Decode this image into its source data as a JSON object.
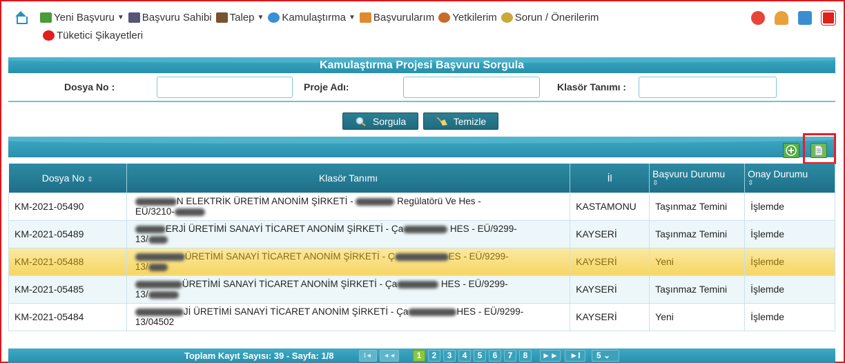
{
  "nav": {
    "items": [
      {
        "label": "Yeni Başvuru",
        "caret": "▼",
        "icon": "new-application-icon",
        "color": "#4a9b3a"
      },
      {
        "label": "Başvuru Sahibi",
        "caret": "",
        "icon": "applicant-icon",
        "color": "#555577"
      },
      {
        "label": "Talep",
        "caret": "▼",
        "icon": "request-icon",
        "color": "#7a5230"
      },
      {
        "label": "Kamulaştırma",
        "caret": "▼",
        "icon": "globe-icon",
        "color": "#3a8fd8"
      },
      {
        "label": "Başvurularım",
        "caret": "",
        "icon": "my-applications-icon",
        "color": "#e08a30"
      },
      {
        "label": "Yetkilerim",
        "caret": "",
        "icon": "permissions-icon",
        "color": "#c76a2a"
      },
      {
        "label": "Sorun / Önerilerim",
        "caret": "",
        "icon": "feedback-icon",
        "color": "#c9a93a"
      }
    ],
    "second_row": {
      "label": "Tüketici Şikayetleri",
      "icon": "consumer-complaint-icon",
      "color": "#e0201b"
    }
  },
  "page": {
    "title": "Kamulaştırma Projesi Başvuru Sorgula"
  },
  "form": {
    "dosya_no_label": "Dosya No :",
    "dosya_no_value": "",
    "proje_adi_label": "Proje Adı:",
    "proje_adi_value": "",
    "klasor_label": "Klasör Tanımı :",
    "klasor_value": ""
  },
  "buttons": {
    "sorgula": "Sorgula",
    "temizle": "Temizle"
  },
  "table": {
    "headers": {
      "dosya_no": "Dosya No",
      "klasor": "Klasör Tanımı",
      "il": "İl",
      "basvuru_durumu": "Başvuru Durumu",
      "onay_durumu": "Onay Durumu"
    },
    "rows": [
      {
        "dosya_no": "KM-2021-05490",
        "klasor_a": "N ELEKTRİK ÜRETİM ANONİM ŞİRKETİ -",
        "klasor_b": "Regülatörü Ve Hes -",
        "klasor_c": "EÜ/3210-",
        "il": "KASTAMONU",
        "basvuru": "Taşınmaz Temini",
        "onay": "İşlemde"
      },
      {
        "dosya_no": "KM-2021-05489",
        "klasor_a": "ERJİ ÜRETİMİ SANAYİ TİCARET ANONİM ŞİRKETİ - Ça",
        "klasor_b": "HES - EÜ/9299-",
        "klasor_c": "13/",
        "il": "KAYSERİ",
        "basvuru": "Taşınmaz Temini",
        "onay": "İşlemde"
      },
      {
        "dosya_no": "KM-2021-05488",
        "klasor_a": "ÜRETİMİ SANAYİ TİCARET ANONİM ŞİRKETİ - Ç",
        "klasor_b": "ES - EÜ/9299-",
        "klasor_c": "13/",
        "il": "KAYSERİ",
        "basvuru": "Yeni",
        "onay": "İşlemde"
      },
      {
        "dosya_no": "KM-2021-05485",
        "klasor_a": "ÜRETİMİ SANAYİ TİCARET ANONİM ŞİRKETİ - Ça",
        "klasor_b": "HES - EÜ/9299-",
        "klasor_c": "13/",
        "il": "KAYSERİ",
        "basvuru": "Taşınmaz Temini",
        "onay": "İşlemde"
      },
      {
        "dosya_no": "KM-2021-05484",
        "klasor_a": "Jİ ÜRETİMİ SANAYİ TİCARET ANONİM ŞİRKETİ - Ça",
        "klasor_b": "HES - EÜ/9299-",
        "klasor_c": "13/04502",
        "il": "KAYSERİ",
        "basvuru": "Yeni",
        "onay": "İşlemde"
      }
    ]
  },
  "pager": {
    "summary": "Toplam Kayıt Sayısı: 39 - Sayfa: 1/8",
    "pages": [
      "1",
      "2",
      "3",
      "4",
      "5",
      "6",
      "7",
      "8"
    ],
    "active_page": "1",
    "page_size": "5",
    "first": "I◄",
    "prev": "◄◄",
    "next": "►►",
    "last": "►I"
  },
  "colors": {
    "accent": "#2790ad",
    "selected_row": "#f6d562",
    "highlight_border": "#ec1c24"
  }
}
